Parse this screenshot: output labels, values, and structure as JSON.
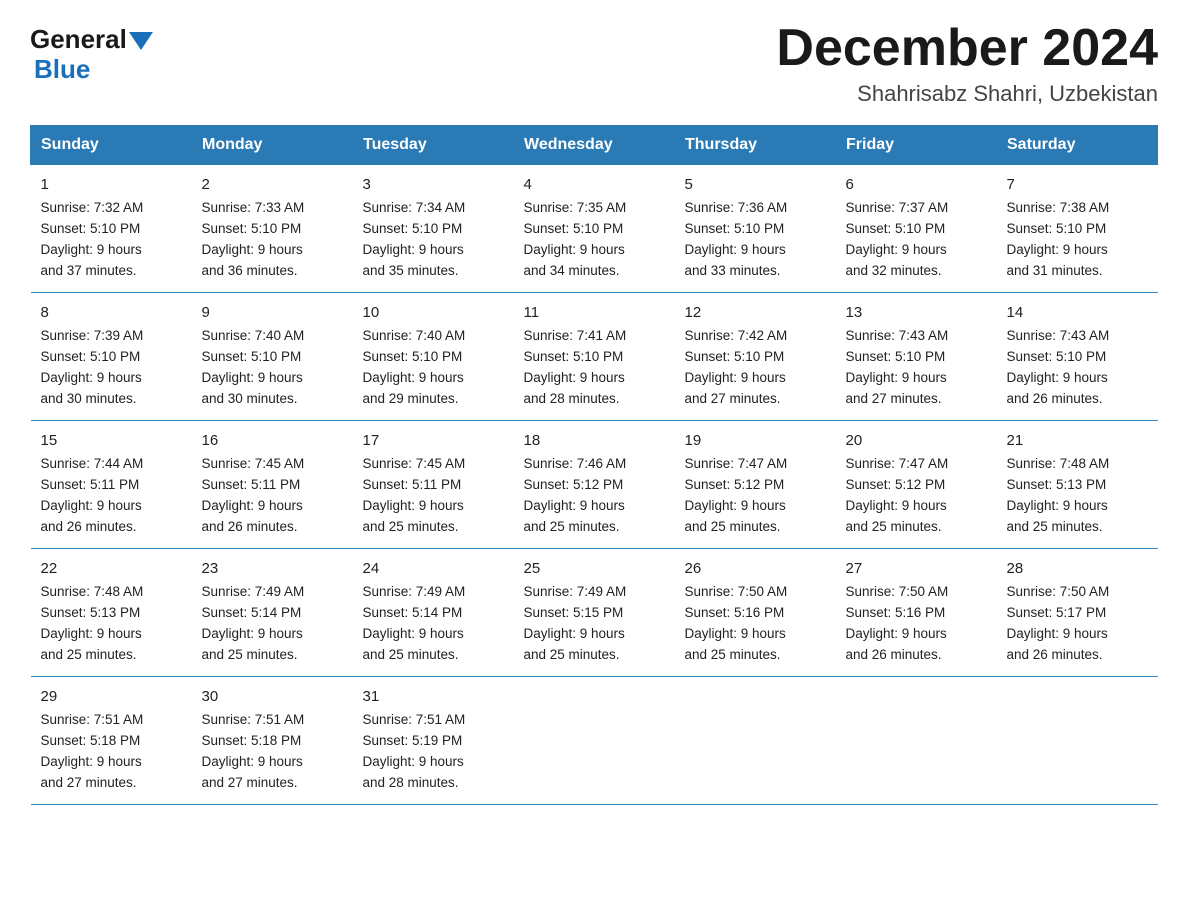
{
  "header": {
    "logo_general": "General",
    "logo_blue": "Blue",
    "title": "December 2024",
    "subtitle": "Shahrisabz Shahri, Uzbekistan"
  },
  "days_of_week": [
    "Sunday",
    "Monday",
    "Tuesday",
    "Wednesday",
    "Thursday",
    "Friday",
    "Saturday"
  ],
  "weeks": [
    [
      {
        "num": "1",
        "sunrise": "7:32 AM",
        "sunset": "5:10 PM",
        "daylight": "9 hours and 37 minutes."
      },
      {
        "num": "2",
        "sunrise": "7:33 AM",
        "sunset": "5:10 PM",
        "daylight": "9 hours and 36 minutes."
      },
      {
        "num": "3",
        "sunrise": "7:34 AM",
        "sunset": "5:10 PM",
        "daylight": "9 hours and 35 minutes."
      },
      {
        "num": "4",
        "sunrise": "7:35 AM",
        "sunset": "5:10 PM",
        "daylight": "9 hours and 34 minutes."
      },
      {
        "num": "5",
        "sunrise": "7:36 AM",
        "sunset": "5:10 PM",
        "daylight": "9 hours and 33 minutes."
      },
      {
        "num": "6",
        "sunrise": "7:37 AM",
        "sunset": "5:10 PM",
        "daylight": "9 hours and 32 minutes."
      },
      {
        "num": "7",
        "sunrise": "7:38 AM",
        "sunset": "5:10 PM",
        "daylight": "9 hours and 31 minutes."
      }
    ],
    [
      {
        "num": "8",
        "sunrise": "7:39 AM",
        "sunset": "5:10 PM",
        "daylight": "9 hours and 30 minutes."
      },
      {
        "num": "9",
        "sunrise": "7:40 AM",
        "sunset": "5:10 PM",
        "daylight": "9 hours and 30 minutes."
      },
      {
        "num": "10",
        "sunrise": "7:40 AM",
        "sunset": "5:10 PM",
        "daylight": "9 hours and 29 minutes."
      },
      {
        "num": "11",
        "sunrise": "7:41 AM",
        "sunset": "5:10 PM",
        "daylight": "9 hours and 28 minutes."
      },
      {
        "num": "12",
        "sunrise": "7:42 AM",
        "sunset": "5:10 PM",
        "daylight": "9 hours and 27 minutes."
      },
      {
        "num": "13",
        "sunrise": "7:43 AM",
        "sunset": "5:10 PM",
        "daylight": "9 hours and 27 minutes."
      },
      {
        "num": "14",
        "sunrise": "7:43 AM",
        "sunset": "5:10 PM",
        "daylight": "9 hours and 26 minutes."
      }
    ],
    [
      {
        "num": "15",
        "sunrise": "7:44 AM",
        "sunset": "5:11 PM",
        "daylight": "9 hours and 26 minutes."
      },
      {
        "num": "16",
        "sunrise": "7:45 AM",
        "sunset": "5:11 PM",
        "daylight": "9 hours and 26 minutes."
      },
      {
        "num": "17",
        "sunrise": "7:45 AM",
        "sunset": "5:11 PM",
        "daylight": "9 hours and 25 minutes."
      },
      {
        "num": "18",
        "sunrise": "7:46 AM",
        "sunset": "5:12 PM",
        "daylight": "9 hours and 25 minutes."
      },
      {
        "num": "19",
        "sunrise": "7:47 AM",
        "sunset": "5:12 PM",
        "daylight": "9 hours and 25 minutes."
      },
      {
        "num": "20",
        "sunrise": "7:47 AM",
        "sunset": "5:12 PM",
        "daylight": "9 hours and 25 minutes."
      },
      {
        "num": "21",
        "sunrise": "7:48 AM",
        "sunset": "5:13 PM",
        "daylight": "9 hours and 25 minutes."
      }
    ],
    [
      {
        "num": "22",
        "sunrise": "7:48 AM",
        "sunset": "5:13 PM",
        "daylight": "9 hours and 25 minutes."
      },
      {
        "num": "23",
        "sunrise": "7:49 AM",
        "sunset": "5:14 PM",
        "daylight": "9 hours and 25 minutes."
      },
      {
        "num": "24",
        "sunrise": "7:49 AM",
        "sunset": "5:14 PM",
        "daylight": "9 hours and 25 minutes."
      },
      {
        "num": "25",
        "sunrise": "7:49 AM",
        "sunset": "5:15 PM",
        "daylight": "9 hours and 25 minutes."
      },
      {
        "num": "26",
        "sunrise": "7:50 AM",
        "sunset": "5:16 PM",
        "daylight": "9 hours and 25 minutes."
      },
      {
        "num": "27",
        "sunrise": "7:50 AM",
        "sunset": "5:16 PM",
        "daylight": "9 hours and 26 minutes."
      },
      {
        "num": "28",
        "sunrise": "7:50 AM",
        "sunset": "5:17 PM",
        "daylight": "9 hours and 26 minutes."
      }
    ],
    [
      {
        "num": "29",
        "sunrise": "7:51 AM",
        "sunset": "5:18 PM",
        "daylight": "9 hours and 27 minutes."
      },
      {
        "num": "30",
        "sunrise": "7:51 AM",
        "sunset": "5:18 PM",
        "daylight": "9 hours and 27 minutes."
      },
      {
        "num": "31",
        "sunrise": "7:51 AM",
        "sunset": "5:19 PM",
        "daylight": "9 hours and 28 minutes."
      },
      null,
      null,
      null,
      null
    ]
  ],
  "labels": {
    "sunrise": "Sunrise:",
    "sunset": "Sunset:",
    "daylight": "Daylight:"
  }
}
